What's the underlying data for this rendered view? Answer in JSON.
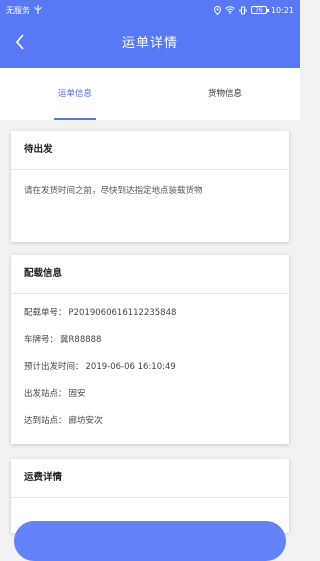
{
  "status_bar": {
    "carrier": "无服务",
    "battery": "76",
    "time": "10:21"
  },
  "nav": {
    "title": "运单详情",
    "back_icon": "chevron-left-icon"
  },
  "tabs": [
    {
      "label": "运单信息",
      "active": true
    },
    {
      "label": "货物信息",
      "active": false
    }
  ],
  "status_card": {
    "title": "待出发",
    "message": "请在发货时间之前，尽快到达指定地点装载货物"
  },
  "load_card": {
    "title": "配载信息",
    "rows": [
      {
        "label": "配载单号：",
        "value": "P2019060616112235848"
      },
      {
        "label": "车牌号：",
        "value": "冀R88888"
      },
      {
        "label": "预计出发时间：",
        "value": "2019-06-06 16:10:49"
      },
      {
        "label": "出发站点：",
        "value": "固安"
      },
      {
        "label": "达到站点：",
        "value": "廊坊安次"
      }
    ]
  },
  "fee_card": {
    "title": "运费详情"
  },
  "colors": {
    "primary": "#5878f6",
    "background": "#f2f2f2"
  }
}
